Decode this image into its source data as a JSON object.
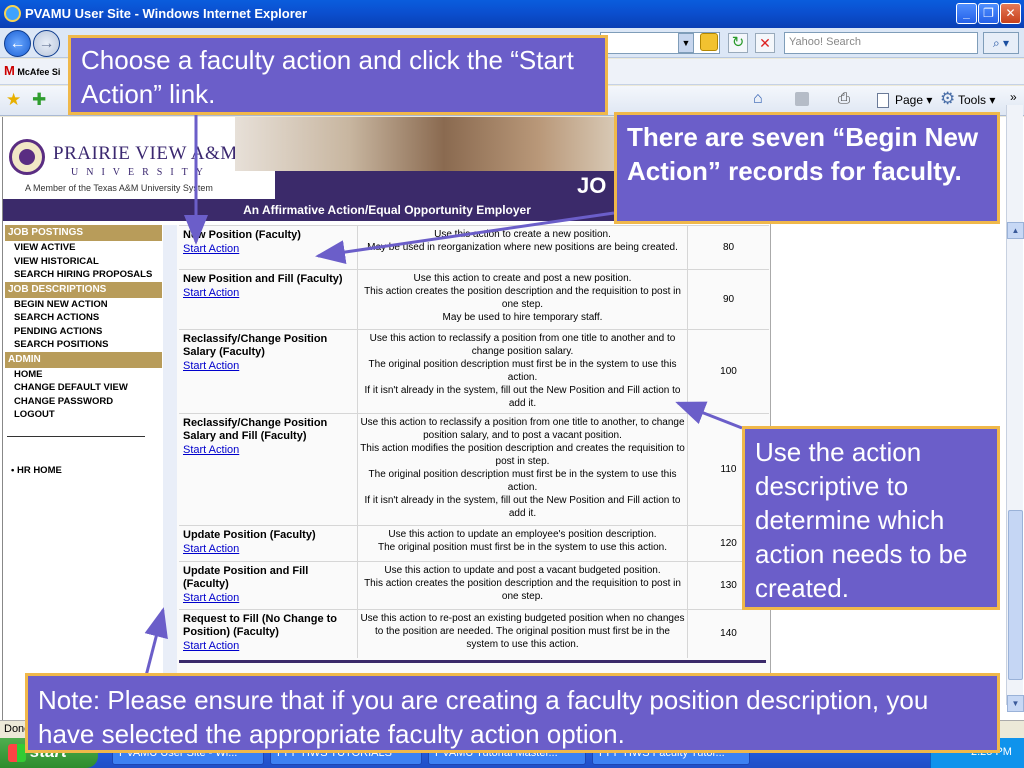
{
  "window": {
    "title": "PVAMU User Site - Windows Internet Explorer"
  },
  "browser": {
    "search_placeholder": "Yahoo! Search",
    "links_item": "McAfee Si",
    "tools": {
      "page": "Page ▾",
      "tools": "Tools ▾",
      "more": "»"
    },
    "status": "Done"
  },
  "site": {
    "name": "PRAIRIE VIEW A&M",
    "university": "UNIVERSITY",
    "member": "A Member of the Texas A&M University System",
    "banner_text": "JO",
    "eoe": "An Affirmative Action/Equal Opportunity Employer"
  },
  "nav": {
    "sections": [
      {
        "title": "JOB POSTINGS",
        "links": [
          "VIEW ACTIVE",
          "VIEW HISTORICAL",
          "SEARCH HIRING PROPOSALS"
        ]
      },
      {
        "title": "JOB DESCRIPTIONS",
        "links": [
          "BEGIN NEW ACTION",
          "SEARCH ACTIONS",
          "PENDING ACTIONS",
          "SEARCH POSITIONS"
        ]
      },
      {
        "title": "ADMIN",
        "links": [
          "HOME",
          "CHANGE DEFAULT VIEW",
          "CHANGE PASSWORD",
          "LOGOUT"
        ]
      }
    ],
    "hr_home": "• HR HOME"
  },
  "actions": {
    "link_label": "Start Action",
    "rows": [
      {
        "name": "New Position (Faculty)",
        "desc": "Use this action to create a new position.\nMay be used in reorganization where new positions are being created.",
        "code": "80"
      },
      {
        "name": "New Position and Fill (Faculty)",
        "desc": "Use this action to create and post a new position.\nThis action creates the position description and the requisition to post in one step.\nMay be used to hire temporary staff.",
        "code": "90"
      },
      {
        "name": "Reclassify/Change Position Salary (Faculty)",
        "desc": "Use this action to reclassify a position from one title to another and to change position salary.\nThe original position description must first be in the system to use this action.\nIf it isn't already in the system, fill out the New Position and Fill action to add it.",
        "code": "100"
      },
      {
        "name": "Reclassify/Change Position Salary and Fill (Faculty)",
        "desc": "Use this action to reclassify a position from one title to another, to change position salary, and to post a vacant position.\nThis action modifies the position description and creates the requisition to post in step.\nThe original position description must first be in the system to use this action.\nIf it isn't already in the system, fill out the New Position and Fill action to add it.",
        "code": "110"
      },
      {
        "name": "Update Position (Faculty)",
        "desc": "Use this action to update an employee's position description.\nThe original position must first be in the system to use this action.",
        "code": "120"
      },
      {
        "name": "Update Position and Fill (Faculty)",
        "desc": "Use this action to update and post a vacant budgeted position.\nThis action creates the position description and the requisition to post in one step.",
        "code": "130"
      },
      {
        "name": "Request to Fill (No Change to Position) (Faculty)",
        "desc": "Use this action to re-post an existing budgeted position when no changes to the position are needed. The original position must first be in the system to use this action.",
        "code": "140"
      }
    ]
  },
  "callouts": {
    "choose": "Choose a faculty action and click the “Start Action” link.",
    "seven": "There are seven “Begin New Action” records for faculty.",
    "descriptive": "Use the action descriptive to determine which action needs to be created.",
    "note": "Note: Please ensure that if you are creating a faculty position description, you have selected the appropriate faculty action option."
  },
  "taskbar": {
    "start": "start",
    "items": [
      "PVAMU User Site - Wi...",
      "PPP HWS TUTORIALS",
      "PVAMU Tutorial Master...",
      "PPP HWS Faculty Tutor..."
    ],
    "clock": "2:25 PM"
  }
}
